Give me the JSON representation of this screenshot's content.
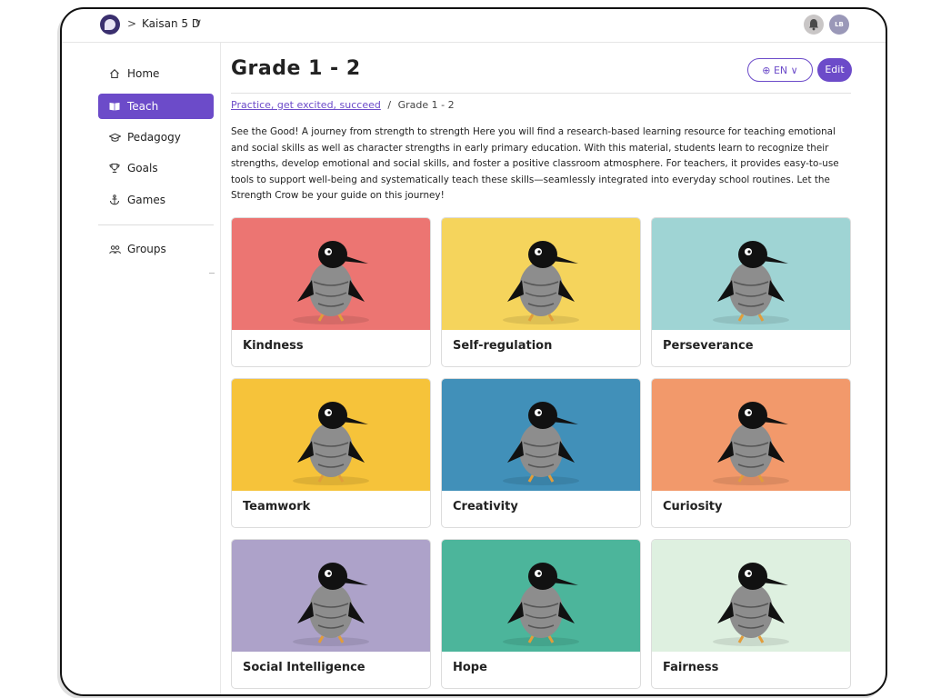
{
  "header": {
    "org_name": "Kaisan 5 D",
    "separator": ">",
    "chevron": "∨",
    "avatar_initials": "LB",
    "icons": [
      "org-logo",
      "bell-icon",
      "avatar"
    ]
  },
  "sidebar": {
    "items": [
      {
        "label": "Home",
        "icon": "home-icon"
      },
      {
        "label": "Teach",
        "icon": "book-icon"
      },
      {
        "label": "Pedagogy",
        "icon": "graduation-cap-icon"
      },
      {
        "label": "Goals",
        "icon": "trophy-icon"
      },
      {
        "label": "Games",
        "icon": "anchor-icon"
      },
      {
        "label": "Groups",
        "icon": "people-icon"
      }
    ]
  },
  "main": {
    "title": "Grade 1 - 2",
    "lang_label": "EN",
    "edit_label": "Edit",
    "breadcrumb": {
      "link": "Practice, get excited, succeed",
      "sep": "/",
      "current": "Grade 1 - 2"
    },
    "description": "See the Good! A journey from strength to strength Here you will find a research-based learning resource for teaching emotional and social skills as well as character strengths in early primary education. With this material, students learn to recognize their strengths, develop emotional and social skills, and foster a positive classroom atmosphere. For teachers, it provides easy-to-use tools to support well-being and systematically teach these skills—seamlessly integrated into everyday school routines. Let the Strength Crow be your guide on this journey!",
    "cards": [
      {
        "title": "Kindness",
        "color": "#ec7572"
      },
      {
        "title": "Self-regulation",
        "color": "#f5d45c"
      },
      {
        "title": "Perseverance",
        "color": "#9fd4d4"
      },
      {
        "title": "Teamwork",
        "color": "#f6c33a"
      },
      {
        "title": "Creativity",
        "color": "#4190b9"
      },
      {
        "title": "Curiosity",
        "color": "#f2996b"
      },
      {
        "title": "Social Intelligence",
        "color": "#ada2c9"
      },
      {
        "title": "Hope",
        "color": "#4cb59b"
      },
      {
        "title": "Fairness",
        "color": "#def0e0"
      }
    ],
    "partial_colors": [
      "#f4d96a",
      "#3c4550",
      "#e7e7e7"
    ]
  }
}
